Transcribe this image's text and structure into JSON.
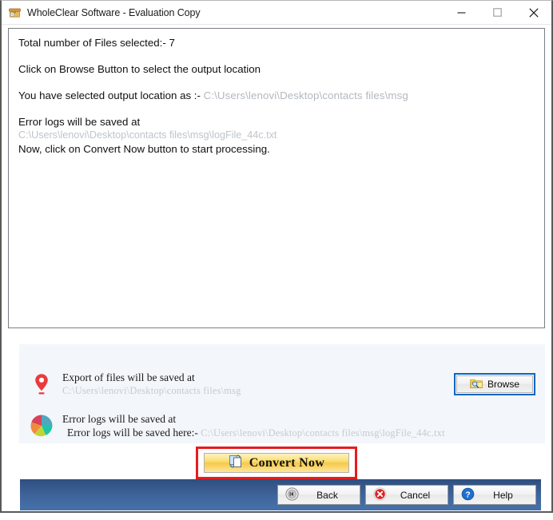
{
  "window": {
    "title": "WholeClear Software - Evaluation Copy",
    "icon": "archive-box-icon",
    "controls": {
      "minimize": "minimize-icon",
      "maximize": "maximize-icon",
      "close": "close-icon"
    }
  },
  "log": {
    "line1": "Total number of Files selected:-  7",
    "line2": "Click on Browse Button to select the output location",
    "line3_label": "You have selected output location as :-  ",
    "line3_path": "C:\\Users\\lenovi\\Desktop\\contacts files\\msg",
    "line4": "Error logs will be saved at",
    "line5_path": "C:\\Users\\lenovi\\Desktop\\contacts files\\msg\\logFile_44c.txt",
    "line6": "Now, click on Convert Now button to start processing."
  },
  "info": {
    "export_row": {
      "icon": "location-pin-icon",
      "title": "Export of files will be saved at",
      "path": "C:\\Users\\lenovi\\Desktop\\contacts files\\msg",
      "browse_label": "Browse",
      "browse_icon": "folder-search-icon"
    },
    "error_row": {
      "icon": "pie-chart-icon",
      "title": "Error logs will be saved at",
      "sub_label": "Error logs will be saved here:- ",
      "sub_path": "C:\\Users\\lenovi\\Desktop\\contacts files\\msg\\logFile_44c.txt"
    }
  },
  "convert": {
    "label": "Convert Now",
    "icon": "convert-pages-icon"
  },
  "footer": {
    "buttons": [
      {
        "label": "Back",
        "icon": "back-arrow-icon"
      },
      {
        "label": "Cancel",
        "icon": "cancel-x-icon"
      },
      {
        "label": "Help",
        "icon": "help-question-icon"
      }
    ]
  },
  "colors": {
    "accent_blue": "#0a66c2",
    "highlight_red": "#e81c1c",
    "convert_gold": "#f7c94b",
    "footer_blue": "#3f659c",
    "panel_bg": "#f3f6fa"
  }
}
